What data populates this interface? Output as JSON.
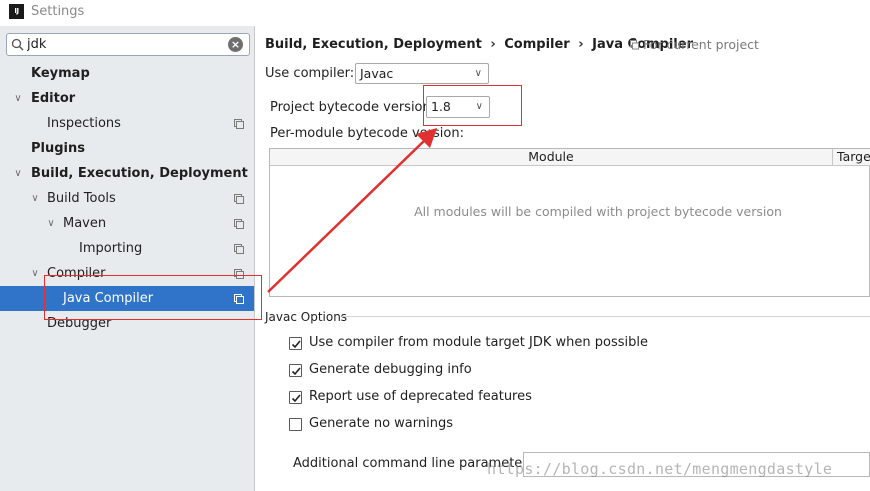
{
  "window": {
    "title": "Settings",
    "logo": "IJ"
  },
  "search": {
    "value": "jdk"
  },
  "sidebar": {
    "items": [
      {
        "label": "Keymap"
      },
      {
        "label": "Editor"
      },
      {
        "label": "Inspections"
      },
      {
        "label": "Plugins"
      },
      {
        "label": "Build, Execution, Deployment"
      },
      {
        "label": "Build Tools"
      },
      {
        "label": "Maven"
      },
      {
        "label": "Importing"
      },
      {
        "label": "Compiler"
      },
      {
        "label": "Java Compiler"
      },
      {
        "label": "Debugger"
      }
    ]
  },
  "breadcrumb": {
    "part1": "Build, Execution, Deployment",
    "part2": "Compiler",
    "part3": "Java Compiler",
    "separator": "›"
  },
  "scope": {
    "label": "For current project"
  },
  "compiler": {
    "label": "Use compiler:",
    "value": "Javac"
  },
  "bytecode": {
    "label": "Project bytecode version:",
    "value": "1.8"
  },
  "per_module": {
    "label": "Per-module bytecode version:",
    "columns": {
      "module": "Module",
      "target": "Target"
    },
    "empty_text": "All modules will be compiled with project bytecode version"
  },
  "javac": {
    "title": "Javac Options",
    "options": [
      {
        "label": "Use compiler from module target JDK when possible",
        "checked": true
      },
      {
        "label": "Generate debugging info",
        "checked": true
      },
      {
        "label": "Report use of deprecated features",
        "checked": true
      },
      {
        "label": "Generate no warnings",
        "checked": false
      }
    ],
    "params_label": "Additional command line parameters:",
    "params_value": ""
  },
  "watermark": "https://blog.csdn.net/mengmengdastyle",
  "colors": {
    "selection": "#2f74c8",
    "annotation": "#e03030",
    "sidebar_bg": "#e8ebee"
  }
}
